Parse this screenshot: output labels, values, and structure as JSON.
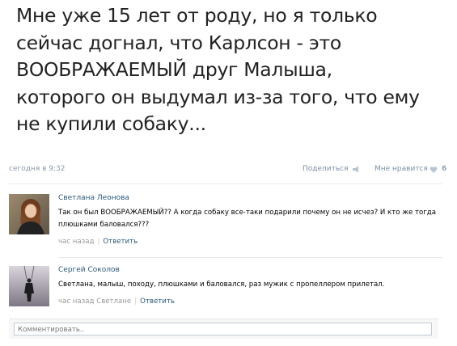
{
  "post": {
    "lines": [
      "Мне уже 15 лет от роду, но я только",
      "сейчас догнал, что Карлсон - это",
      "ВООБРАЖАЕМЫЙ друг Малыша,",
      "которого он выдумал из-за того, что ему",
      "не купили собаку..."
    ],
    "date": "сегодня в 9:32",
    "share_label": "Поделиться",
    "like_label": "Мне нравится",
    "like_count": "6"
  },
  "comments": [
    {
      "author": "Светлана Леонова",
      "text": "Так он был ВООБРАЖАЕМЫЙ?? А когда собаку все-таки подарили почему он не исчез? И кто же тогда плюшками баловался???",
      "time": "час назад",
      "reply": "Ответить"
    },
    {
      "author": "Сергей Соколов",
      "text": "Светлана, малыш, походу, плюшками и баловался, раз мужик с пропеллером прилетал.",
      "time": "час назад Светлане",
      "reply": "Ответить"
    }
  ],
  "comment_input": {
    "placeholder": "Комментировать.."
  },
  "colors": {
    "link": "#2b587a",
    "meta": "#999999",
    "like_gray": "#8ea3b8"
  }
}
